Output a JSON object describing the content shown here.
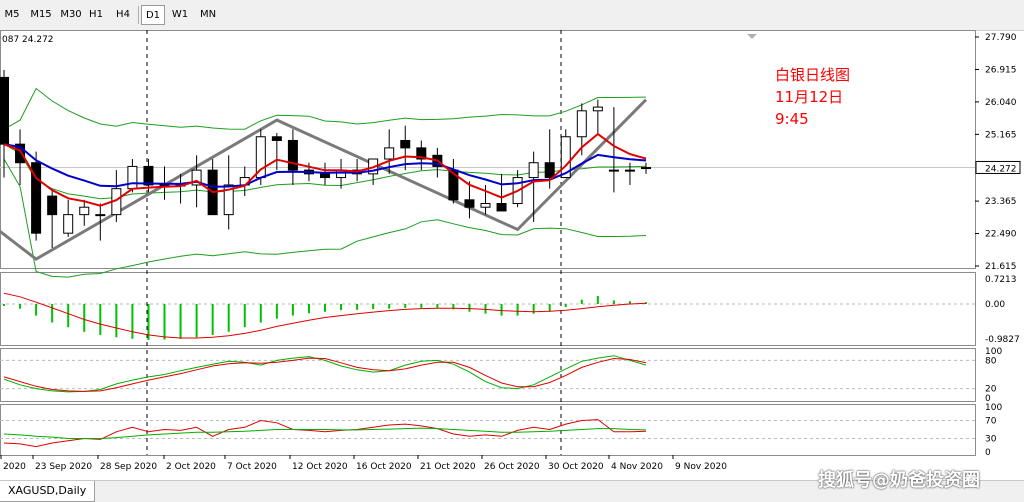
{
  "toolbar": {
    "timeframes": [
      "M5",
      "M15",
      "M30",
      "H1",
      "H4",
      "D1",
      "W1",
      "MN"
    ],
    "active": "D1"
  },
  "chart": {
    "info_text": "087 24.272",
    "symbol_tab": "XAGUSD,Daily",
    "annotation": [
      "白银日线图",
      "11月12日",
      "9:45"
    ],
    "price_tag": "24.272",
    "price_axis_labels": [
      "27.790",
      "26.915",
      "26.040",
      "25.165",
      "24.272",
      "23.365",
      "22.490",
      "21.615"
    ],
    "macd_axis_labels": [
      "0.7213",
      "0.00",
      "-0.9827"
    ],
    "stoch_axis_labels": [
      "100",
      "80",
      "20",
      "0"
    ],
    "rsi_axis_labels": [
      "100",
      "70",
      "30",
      "0"
    ],
    "date_labels": [
      "2020",
      "23 Sep 2020",
      "28 Sep 2020",
      "2 Oct 2020",
      "7 Oct 2020",
      "12 Oct 2020",
      "16 Oct 2020",
      "21 Oct 2020",
      "26 Oct 2020",
      "30 Oct 2020",
      "4 Nov 2020",
      "9 Nov 2020"
    ],
    "watermark": "搜狐号@奶爸投资圈"
  },
  "colors": {
    "bull": "#ffffff",
    "bear": "#000000",
    "ma_fast": "#e00000",
    "ma_slow": "#0000c8",
    "band": "#1e9e1e",
    "zigzag": "#7a7a7a",
    "annotation": "#ff0000"
  },
  "chart_data": {
    "type": "candlestick",
    "symbol": "XAGUSD",
    "timeframe": "Daily",
    "ylim": [
      21.615,
      27.79
    ],
    "x": [
      "17 Sep",
      "18 Sep",
      "21 Sep",
      "22 Sep",
      "23 Sep",
      "24 Sep",
      "25 Sep",
      "28 Sep",
      "29 Sep",
      "30 Sep",
      "1 Oct",
      "2 Oct",
      "5 Oct",
      "6 Oct",
      "7 Oct",
      "8 Oct",
      "9 Oct",
      "12 Oct",
      "13 Oct",
      "14 Oct",
      "15 Oct",
      "16 Oct",
      "19 Oct",
      "20 Oct",
      "21 Oct",
      "22 Oct",
      "23 Oct",
      "26 Oct",
      "27 Oct",
      "28 Oct",
      "29 Oct",
      "30 Oct",
      "2 Nov",
      "3 Nov",
      "4 Nov",
      "5 Nov",
      "6 Nov",
      "9 Nov",
      "10 Nov",
      "11 Nov",
      "12 Nov"
    ],
    "open": [
      26.7,
      24.9,
      24.4,
      23.5,
      22.5,
      23.0,
      23.0,
      23.0,
      23.7,
      24.3,
      23.8,
      23.8,
      23.8,
      24.2,
      23.0,
      23.8,
      24.0,
      25.1,
      25.0,
      24.2,
      24.1,
      24.0,
      24.2,
      24.1,
      24.5,
      25.0,
      24.8,
      24.6,
      24.2,
      23.4,
      23.2,
      23.3,
      23.3,
      24.0,
      24.4,
      24.0,
      25.1,
      25.8,
      24.2,
      24.2,
      24.26
    ],
    "high": [
      26.9,
      25.3,
      24.7,
      23.7,
      23.4,
      23.4,
      23.3,
      24.2,
      24.5,
      24.5,
      24.3,
      24.1,
      24.6,
      24.5,
      24.6,
      24.3,
      25.3,
      25.2,
      25.3,
      24.4,
      24.4,
      24.5,
      24.5,
      24.4,
      25.3,
      25.4,
      25.0,
      24.8,
      24.5,
      23.9,
      23.8,
      24.1,
      24.2,
      24.7,
      25.3,
      25.3,
      26.0,
      26.1,
      25.9,
      24.4,
      24.4
    ],
    "low": [
      24.0,
      23.8,
      22.3,
      22.1,
      22.4,
      22.7,
      22.3,
      22.8,
      23.6,
      23.6,
      23.4,
      23.3,
      23.2,
      23.1,
      22.6,
      23.5,
      23.8,
      24.2,
      23.8,
      23.9,
      23.8,
      23.7,
      23.9,
      23.8,
      24.1,
      24.2,
      24.2,
      24.0,
      23.3,
      22.9,
      23.0,
      23.1,
      23.2,
      22.8,
      23.7,
      24.0,
      24.6,
      25.2,
      23.6,
      23.8,
      24.1
    ],
    "close": [
      24.9,
      24.4,
      22.5,
      23.0,
      23.0,
      23.2,
      23.0,
      23.7,
      24.3,
      23.8,
      23.8,
      23.8,
      24.2,
      23.0,
      23.8,
      24.0,
      25.1,
      25.0,
      24.2,
      24.1,
      24.0,
      24.2,
      24.1,
      24.5,
      24.8,
      24.8,
      24.5,
      24.3,
      23.4,
      23.2,
      23.3,
      23.1,
      24.0,
      24.4,
      24.0,
      25.1,
      25.8,
      25.9,
      24.2,
      24.2,
      24.27
    ],
    "macd_hist": [
      -0.05,
      -0.12,
      -0.3,
      -0.48,
      -0.6,
      -0.72,
      -0.8,
      -0.86,
      -0.9,
      -0.93,
      -0.92,
      -0.9,
      -0.86,
      -0.8,
      -0.72,
      -0.6,
      -0.48,
      -0.38,
      -0.3,
      -0.24,
      -0.2,
      -0.16,
      -0.15,
      -0.13,
      -0.12,
      -0.1,
      -0.1,
      -0.1,
      -0.14,
      -0.2,
      -0.25,
      -0.3,
      -0.3,
      -0.25,
      -0.2,
      -0.08,
      0.12,
      0.22,
      0.1,
      0.08,
      0.05
    ],
    "macd_signal": [
      0.3,
      0.2,
      0.05,
      -0.1,
      -0.25,
      -0.4,
      -0.52,
      -0.62,
      -0.72,
      -0.8,
      -0.85,
      -0.88,
      -0.88,
      -0.86,
      -0.82,
      -0.76,
      -0.68,
      -0.58,
      -0.5,
      -0.42,
      -0.35,
      -0.3,
      -0.25,
      -0.21,
      -0.17,
      -0.14,
      -0.12,
      -0.11,
      -0.11,
      -0.12,
      -0.14,
      -0.17,
      -0.19,
      -0.2,
      -0.19,
      -0.16,
      -0.12,
      -0.07,
      -0.03,
      0.0,
      0.02
    ],
    "stoch_k": [
      40,
      28,
      20,
      15,
      13,
      14,
      18,
      30,
      38,
      45,
      50,
      58,
      65,
      72,
      78,
      76,
      70,
      80,
      85,
      88,
      80,
      68,
      60,
      55,
      58,
      70,
      78,
      80,
      72,
      55,
      35,
      22,
      20,
      28,
      45,
      62,
      78,
      85,
      90,
      80,
      70
    ],
    "stoch_d": [
      45,
      35,
      25,
      18,
      15,
      14,
      15,
      22,
      30,
      38,
      45,
      52,
      60,
      68,
      73,
      75,
      74,
      76,
      80,
      85,
      84,
      75,
      65,
      60,
      58,
      62,
      70,
      76,
      76,
      65,
      48,
      32,
      24,
      24,
      33,
      48,
      65,
      76,
      84,
      82,
      75
    ],
    "rsi": [
      20,
      18,
      12,
      20,
      25,
      30,
      28,
      45,
      55,
      45,
      50,
      48,
      55,
      35,
      50,
      55,
      70,
      65,
      50,
      48,
      45,
      48,
      50,
      55,
      60,
      62,
      58,
      52,
      40,
      35,
      38,
      35,
      48,
      55,
      50,
      62,
      70,
      72,
      45,
      45,
      46
    ],
    "rsi_ma": [
      40,
      38,
      35,
      33,
      30,
      30,
      30,
      32,
      35,
      38,
      40,
      42,
      44,
      44,
      45,
      46,
      48,
      50,
      50,
      50,
      50,
      49,
      49,
      50,
      51,
      52,
      53,
      52,
      50,
      48,
      46,
      44,
      44,
      45,
      46,
      48,
      50,
      52,
      52,
      50,
      49
    ]
  }
}
